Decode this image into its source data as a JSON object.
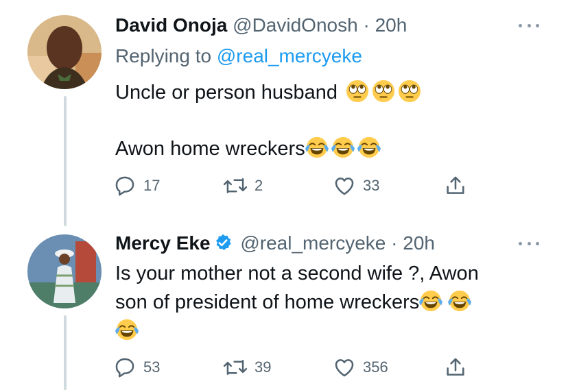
{
  "tweets": [
    {
      "name": "David Onoja",
      "handle": "@DavidOnosh",
      "separator": "·",
      "time": "20h",
      "replying_prefix": "Replying to",
      "replying_handle": "@real_mercyeke",
      "line1": "Uncle or person husband",
      "line1_emoji": "face-with-rolling-eyes",
      "line2": "Awon home wreckers",
      "line2_emoji": "face-with-tears-of-joy",
      "replies": "17",
      "retweets": "2",
      "likes": "33"
    },
    {
      "name": "Mercy Eke",
      "verified": true,
      "handle": "@real_mercyeke",
      "separator": "·",
      "time": "20h",
      "line1": "Is your mother not a second wife ?, Awon",
      "line2": "son of president of home wreckers",
      "emoji": "face-with-tears-of-joy",
      "replies": "53",
      "retweets": "39",
      "likes": "356"
    }
  ],
  "colors": {
    "link": "#1d9bf0",
    "secondary_text": "#536471",
    "thread_line": "#cfd9de"
  }
}
